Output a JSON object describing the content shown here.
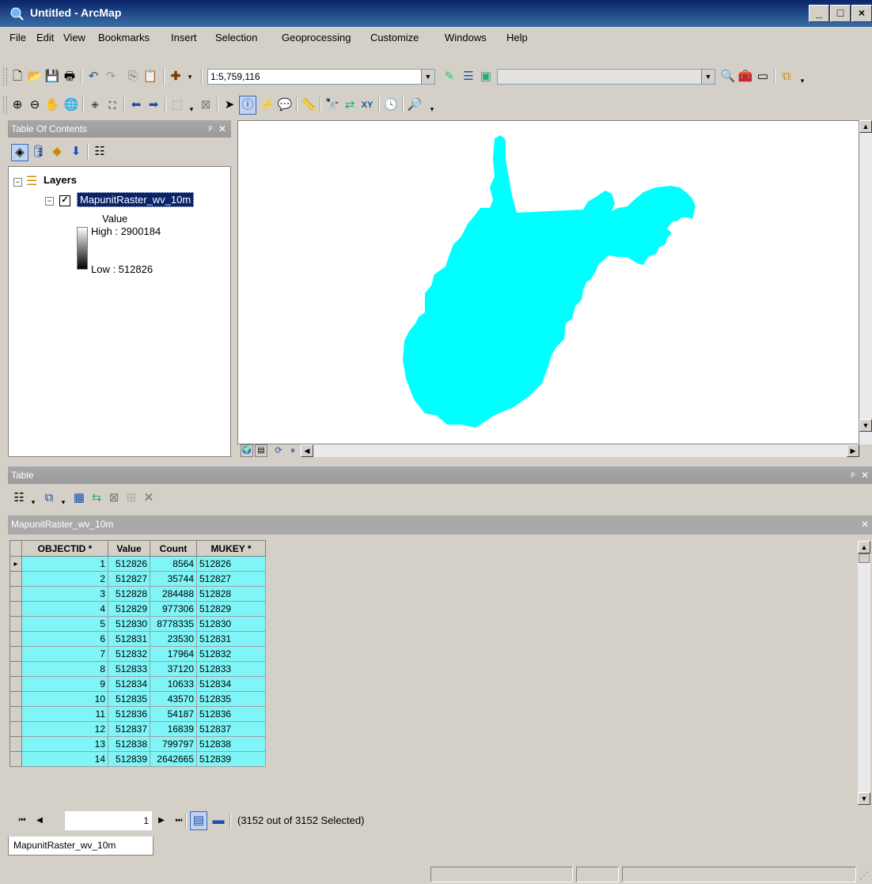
{
  "window": {
    "title": "Untitled - ArcMap",
    "minimize": "_",
    "maximize": "□",
    "close": "×"
  },
  "menu": [
    "File",
    "Edit",
    "View",
    "Bookmarks",
    "Insert",
    "Selection",
    "Geoprocessing",
    "Customize",
    "Windows",
    "Help"
  ],
  "toolbar": {
    "scale_value": "1:5,759,116"
  },
  "toc": {
    "title": "Table Of Contents",
    "group_label": "Layers",
    "layer_name": "MapunitRaster_wv_10m",
    "legend_title": "Value",
    "legend_high": "High : 2900184",
    "legend_low": "Low : 512826"
  },
  "map": {
    "fill_color": "#00ffff"
  },
  "table_window": {
    "title": "Table",
    "table_name": "MapunitRaster_wv_10m",
    "columns": [
      "OBJECTID *",
      "Value",
      "Count",
      "MUKEY *"
    ],
    "rows": [
      [
        "1",
        "512826",
        "8564",
        "512826"
      ],
      [
        "2",
        "512827",
        "35744",
        "512827"
      ],
      [
        "3",
        "512828",
        "284488",
        "512828"
      ],
      [
        "4",
        "512829",
        "977306",
        "512829"
      ],
      [
        "5",
        "512830",
        "8778335",
        "512830"
      ],
      [
        "6",
        "512831",
        "23530",
        "512831"
      ],
      [
        "7",
        "512832",
        "17964",
        "512832"
      ],
      [
        "8",
        "512833",
        "37120",
        "512833"
      ],
      [
        "9",
        "512834",
        "10633",
        "512834"
      ],
      [
        "10",
        "512835",
        "43570",
        "512835"
      ],
      [
        "11",
        "512836",
        "54187",
        "512836"
      ],
      [
        "12",
        "512837",
        "16839",
        "512837"
      ],
      [
        "13",
        "512838",
        "799797",
        "512838"
      ],
      [
        "14",
        "512839",
        "2642665",
        "512839"
      ]
    ],
    "nav_record": "1",
    "selection_status": "(3152 out of 3152 Selected)",
    "tab_label": "MapunitRaster_wv_10m",
    "selection_color": "#7ff5f8"
  }
}
